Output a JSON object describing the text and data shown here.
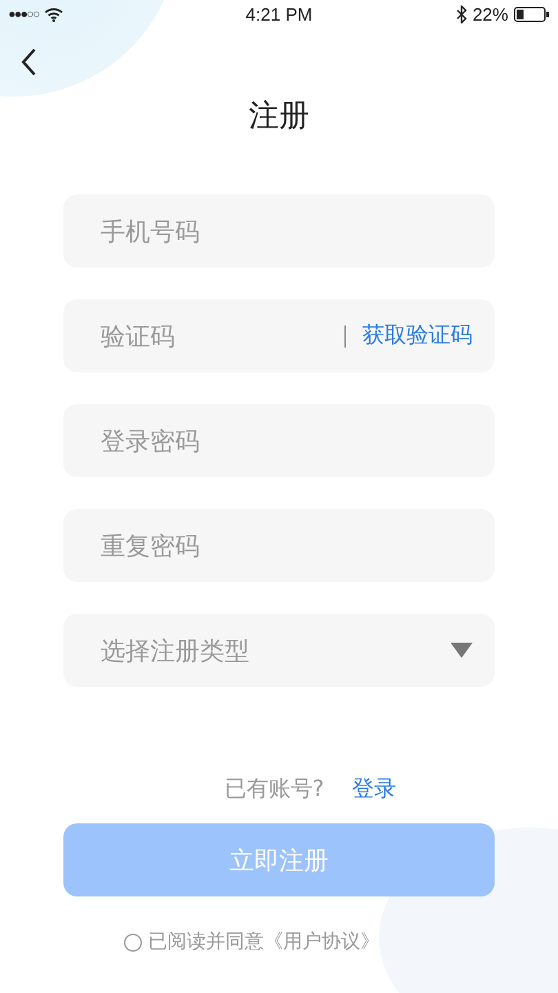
{
  "status_bar": {
    "signal": "●●●○○",
    "time": "4:21 PM",
    "battery": "22%"
  },
  "title": "注册",
  "fields": [
    {
      "kind": "text",
      "placeholder": "手机号码"
    },
    {
      "kind": "code",
      "placeholder": "验证码",
      "action": "获取验证码"
    },
    {
      "kind": "password",
      "placeholder": "登录密码"
    },
    {
      "kind": "password",
      "placeholder": "重复密码"
    },
    {
      "kind": "select",
      "placeholder": "选择注册类型"
    }
  ],
  "login_prompt": {
    "text": "已有账号?",
    "link": "登录"
  },
  "submit": {
    "label": "立即注册",
    "disabled": true
  },
  "agreement": {
    "text": "已阅读并同意《用户协议》",
    "checked": false
  }
}
